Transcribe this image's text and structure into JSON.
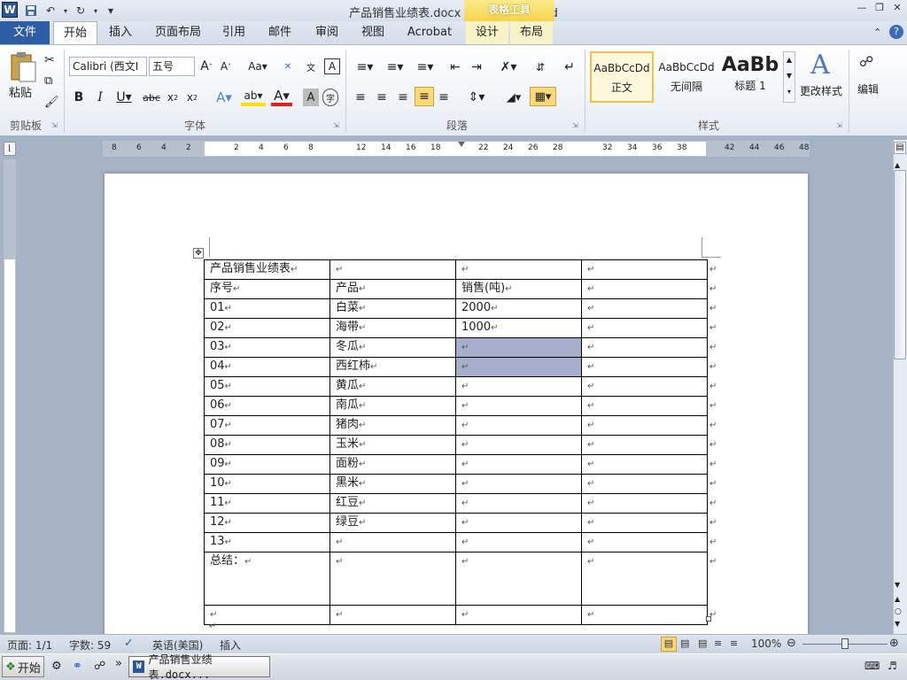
{
  "window": {
    "title": "产品销售业绩表.docx - Microsoft Word",
    "context_tab_group": "表格工具"
  },
  "quick_access": {
    "save_icon": "save-icon",
    "undo_icon": "undo-icon",
    "redo_icon": "redo-icon"
  },
  "tabs": [
    {
      "label": "文件"
    },
    {
      "label": "开始"
    },
    {
      "label": "插入"
    },
    {
      "label": "页面布局"
    },
    {
      "label": "引用"
    },
    {
      "label": "邮件"
    },
    {
      "label": "审阅"
    },
    {
      "label": "视图"
    },
    {
      "label": "Acrobat"
    },
    {
      "label": "设计"
    },
    {
      "label": "布局"
    }
  ],
  "ribbon": {
    "clipboard": {
      "paste_label": "粘贴",
      "group_label": "剪贴板"
    },
    "font": {
      "font_name": "Calibri (西文I",
      "font_size": "五号",
      "group_label": "字体"
    },
    "paragraph": {
      "group_label": "段落"
    },
    "styles": {
      "group_label": "样式",
      "items": [
        {
          "preview": "AaBbCcDd",
          "name": "正文"
        },
        {
          "preview": "AaBbCcDd",
          "name": "无间隔"
        },
        {
          "preview": "AaBb",
          "name": "标题 1"
        }
      ],
      "change_styles_label": "更改样式"
    },
    "editing": {
      "label": "编辑"
    }
  },
  "ruler": {
    "left_ticks": [
      "8",
      "6",
      "4",
      "2"
    ],
    "main_ticks": [
      "2",
      "4",
      "6",
      "8",
      "12",
      "14",
      "16",
      "18",
      "22",
      "24",
      "26",
      "28",
      "32",
      "34",
      "36",
      "38",
      "42",
      "44",
      "46",
      "48"
    ]
  },
  "table": {
    "rows": [
      [
        "产品销售业绩表",
        "",
        "",
        ""
      ],
      [
        "序号",
        "产品",
        "销售(吨)",
        ""
      ],
      [
        "01",
        "白菜",
        "2000",
        ""
      ],
      [
        "02",
        "海带",
        "1000",
        ""
      ],
      [
        "03",
        "冬瓜",
        "",
        ""
      ],
      [
        "04",
        "西红柿",
        "",
        ""
      ],
      [
        "05",
        "黄瓜",
        "",
        ""
      ],
      [
        "06",
        "南瓜",
        "",
        ""
      ],
      [
        "07",
        "猪肉",
        "",
        ""
      ],
      [
        "08",
        "玉米",
        "",
        ""
      ],
      [
        "09",
        "面粉",
        "",
        ""
      ],
      [
        "10",
        "黑米",
        "",
        ""
      ],
      [
        "11",
        "红豆",
        "",
        ""
      ],
      [
        "12",
        "绿豆",
        "",
        ""
      ],
      [
        "13",
        "",
        "",
        ""
      ],
      [
        "总结：",
        "",
        "",
        ""
      ],
      [
        "",
        "",
        "",
        ""
      ]
    ]
  },
  "status": {
    "page": "页面: 1/1",
    "words": "字数: 59",
    "language": "英语(美国)",
    "mode": "插入",
    "zoom": "100%"
  },
  "taskbar": {
    "start_label": "开始",
    "task_label": "产品销售业绩表.docx..."
  }
}
